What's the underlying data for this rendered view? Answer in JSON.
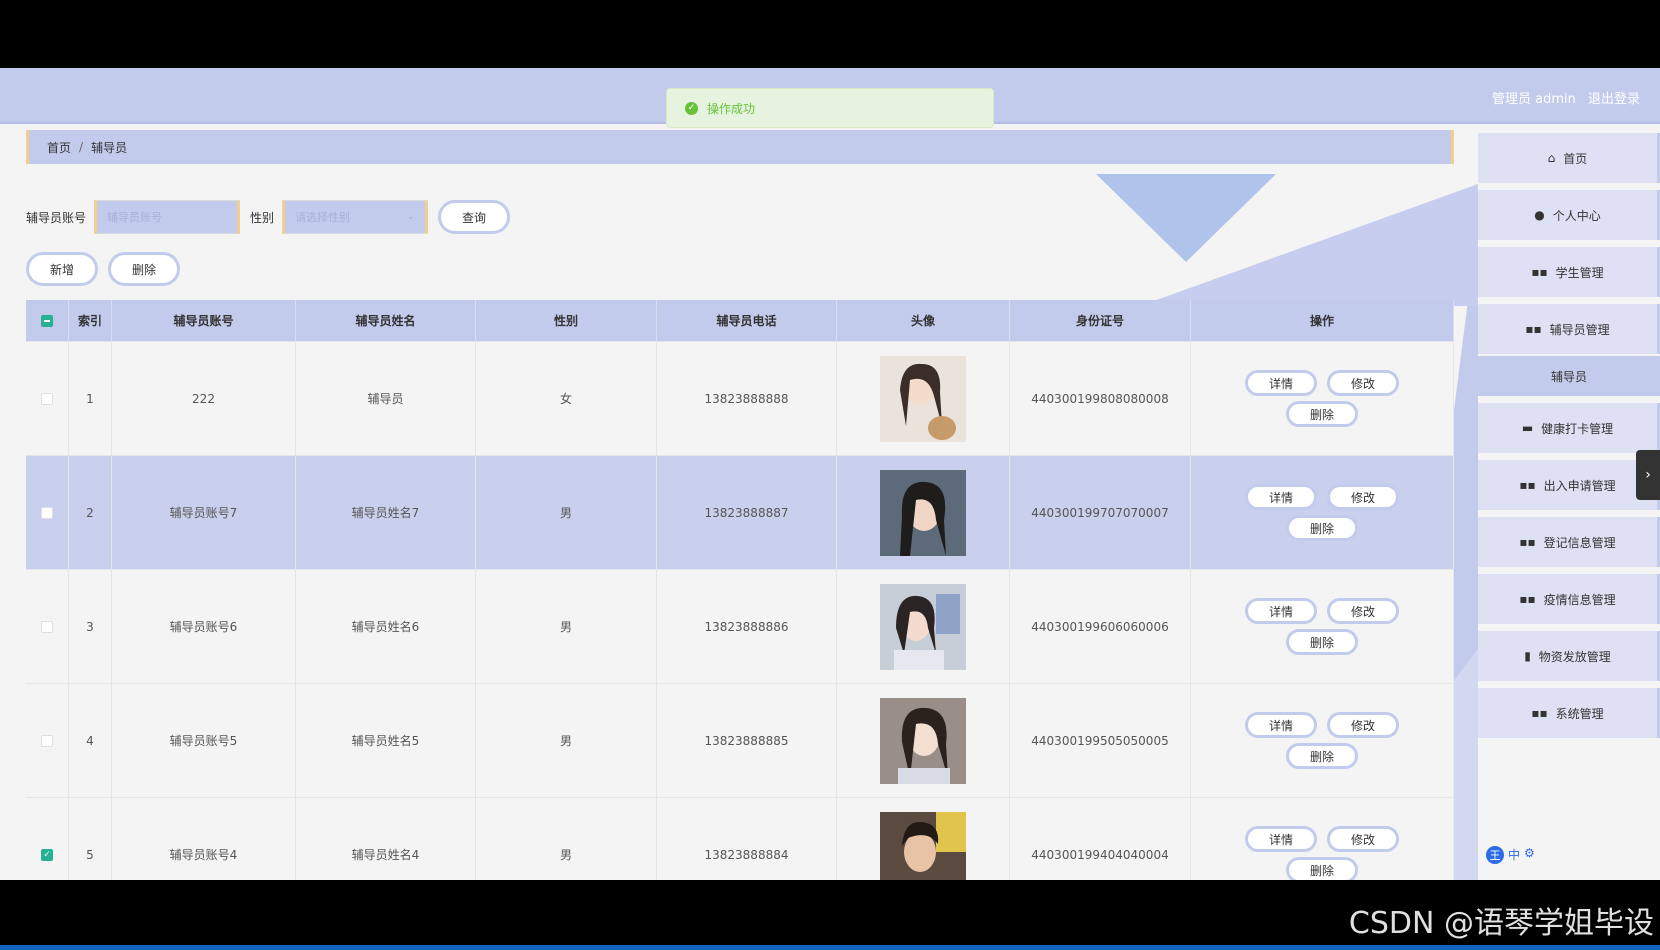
{
  "topbar": {
    "role": "管理员 admin",
    "logout": "退出登录"
  },
  "toast": {
    "message": "操作成功"
  },
  "breadcrumb": {
    "home": "首页",
    "current": "辅导员"
  },
  "search": {
    "account_label": "辅导员账号",
    "account_placeholder": "辅导员账号",
    "gender_label": "性别",
    "gender_placeholder": "请选择性别",
    "query": "查询"
  },
  "actions": {
    "add": "新增",
    "delete": "删除"
  },
  "table": {
    "headers": [
      "索引",
      "辅导员账号",
      "辅导员姓名",
      "性别",
      "辅导员电话",
      "头像",
      "身份证号",
      "操作"
    ],
    "rows": [
      {
        "index": "1",
        "account": "222",
        "name": "辅导员",
        "gender": "女",
        "phone": "13823888888",
        "id": "440300199808080008",
        "checked": false
      },
      {
        "index": "2",
        "account": "辅导员账号7",
        "name": "辅导员姓名7",
        "gender": "男",
        "phone": "13823888887",
        "id": "440300199707070007",
        "checked": false
      },
      {
        "index": "3",
        "account": "辅导员账号6",
        "name": "辅导员姓名6",
        "gender": "男",
        "phone": "13823888886",
        "id": "440300199606060006",
        "checked": false
      },
      {
        "index": "4",
        "account": "辅导员账号5",
        "name": "辅导员姓名5",
        "gender": "男",
        "phone": "13823888885",
        "id": "440300199505050005",
        "checked": false
      },
      {
        "index": "5",
        "account": "辅导员账号4",
        "name": "辅导员姓名4",
        "gender": "男",
        "phone": "13823888884",
        "id": "440300199404040004",
        "checked": true
      }
    ],
    "op_detail": "详情",
    "op_edit": "修改",
    "op_delete": "删除"
  },
  "sidebar": {
    "items": [
      {
        "label": "首页",
        "icon": "home-icon"
      },
      {
        "label": "个人中心",
        "icon": "user-icon"
      },
      {
        "label": "学生管理",
        "icon": "grid-icon"
      },
      {
        "label": "辅导员管理",
        "icon": "grid-icon"
      },
      {
        "label": "健康打卡管理",
        "icon": "briefcase-icon"
      },
      {
        "label": "出入申请管理",
        "icon": "grid-icon"
      },
      {
        "label": "登记信息管理",
        "icon": "grid-icon"
      },
      {
        "label": "疫情信息管理",
        "icon": "grid-icon"
      },
      {
        "label": "物资发放管理",
        "icon": "clipboard-icon"
      },
      {
        "label": "系统管理",
        "icon": "grid-icon"
      }
    ],
    "sub_item": "辅导员"
  },
  "watermark": "CSDN @语琴学姐毕设",
  "colors": {
    "accent": "#c3cbec",
    "border_accent": "#f3cf8e",
    "success": "#67c23a"
  }
}
